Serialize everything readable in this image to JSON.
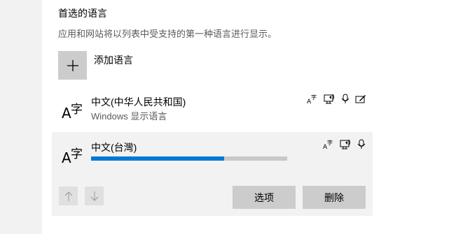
{
  "section": {
    "title": "首选的语言",
    "description": "应用和网站将以列表中受支持的第一种语言进行显示。"
  },
  "add_language": {
    "label": "添加语言",
    "icon": "plus-icon"
  },
  "languages": [
    {
      "name": "中文(中华人民共和国)",
      "subtitle": "Windows 显示语言",
      "glyph_a": "A",
      "glyph_zi": "字",
      "features": [
        "language-pack-icon",
        "text-to-speech-icon",
        "speech-recognition-icon",
        "handwriting-icon"
      ]
    },
    {
      "name": "中文(台灣)",
      "glyph_a": "A",
      "glyph_zi": "字",
      "features": [
        "language-pack-icon",
        "text-to-speech-icon",
        "speech-recognition-icon"
      ],
      "download_progress": 0.68,
      "buttons": {
        "move_up_icon": "arrow-up-icon",
        "move_down_icon": "arrow-down-icon",
        "options": "选项",
        "remove": "删除"
      }
    }
  ],
  "colors": {
    "accent": "#0078d7",
    "selected_background": "#f2f2f2",
    "button_background": "#cccccc"
  }
}
